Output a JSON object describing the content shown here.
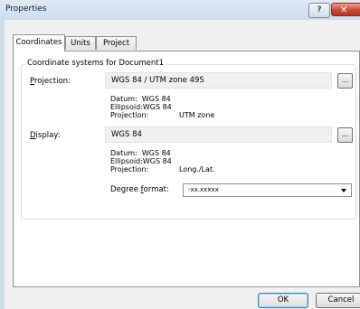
{
  "window": {
    "title": "Properties",
    "help_label": "?",
    "close_label": "✕"
  },
  "tabs": [
    {
      "label": "Coordinates",
      "active": true
    },
    {
      "label": "Units",
      "active": false
    },
    {
      "label": "Project",
      "active": false
    }
  ],
  "group": {
    "legend": "Coordinate systems for Document1"
  },
  "projection": {
    "label_prefix": "",
    "label_accel": "P",
    "label_suffix": "rojection:",
    "value": "WGS 84 / UTM zone 49S",
    "browse_label": "...",
    "datum_key": "Datum:",
    "datum_value": "WGS 84",
    "ellipsoid_key": "Ellipsoid:",
    "ellipsoid_value": "WGS 84",
    "proj_key": "Projection:",
    "proj_value": "UTM zone"
  },
  "display": {
    "label_prefix": "",
    "label_accel": "D",
    "label_suffix": "isplay:",
    "value": "WGS 84",
    "browse_label": "...",
    "datum_key": "Datum:",
    "datum_value": "WGS 84",
    "ellipsoid_key": "Ellipsoid:",
    "ellipsoid_value": "WGS 84",
    "proj_key": "Projection:",
    "proj_value": "Long./Lat."
  },
  "degree_format": {
    "label_prefix": "Degree ",
    "label_accel": "f",
    "label_suffix": "ormat:",
    "selected": "-xx.xxxxx"
  },
  "buttons": {
    "ok": "OK",
    "cancel": "Cancel"
  }
}
